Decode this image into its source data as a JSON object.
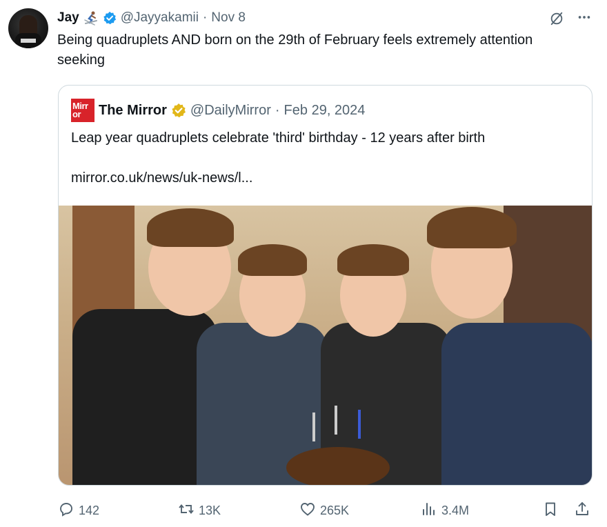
{
  "author": {
    "name": "Jay",
    "handle": "@Jayyakamii",
    "separator": "·",
    "date": "Nov 8"
  },
  "tweet": {
    "text": "Being quadruplets AND born on the 29th of February feels extremely attention seeking"
  },
  "quote": {
    "logo_text_line1": "Mirr",
    "logo_text_line2": "or",
    "name": "The Mirror",
    "handle": "@DailyMirror",
    "separator": "·",
    "date": "Feb 29, 2024",
    "text": "Leap year quadruplets celebrate 'third' birthday - 12 years after birth",
    "link": "mirror.co.uk/news/uk-news/l..."
  },
  "actions": {
    "replies": "142",
    "reposts": "13K",
    "likes": "265K",
    "views": "3.4M"
  },
  "colors": {
    "verified_blue": "#1d9bf0",
    "verified_gold": "#e2b719",
    "muted": "#536471",
    "mirror_red": "#d8232a"
  },
  "icons": [
    "skier-emoji",
    "verified-badge-icon",
    "grok-icon",
    "more-icon",
    "reply-icon",
    "repost-icon",
    "like-icon",
    "views-icon",
    "bookmark-icon",
    "share-icon"
  ]
}
